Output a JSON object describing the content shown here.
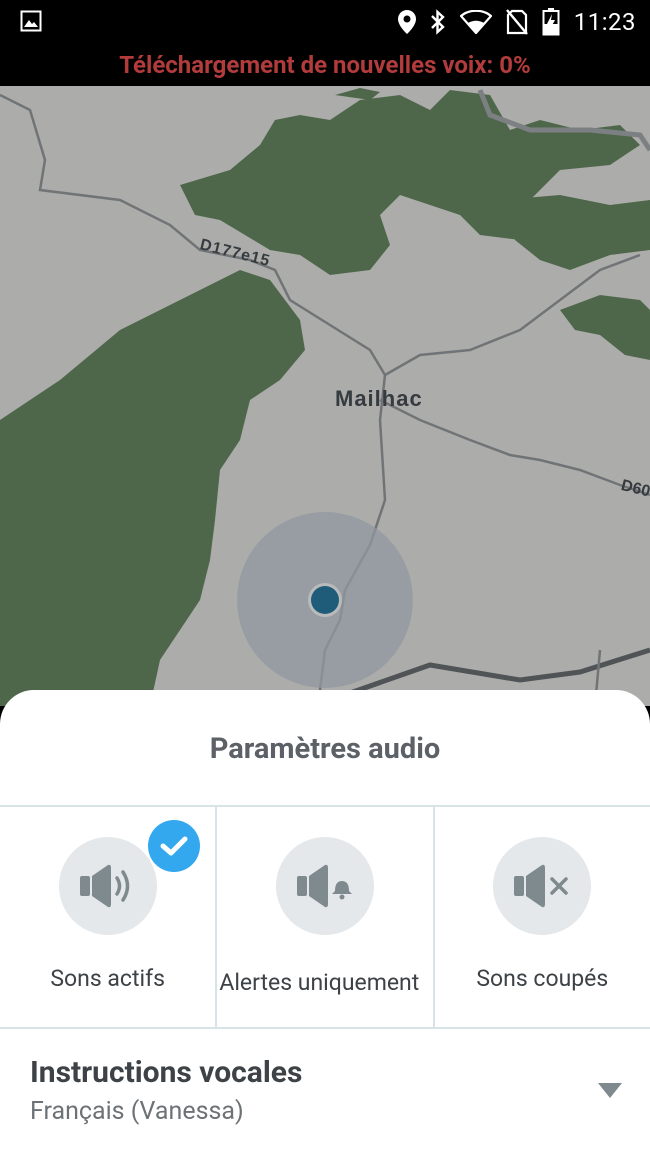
{
  "status_bar": {
    "time": "11:23",
    "icons": [
      "image-icon",
      "location-icon",
      "bluetooth-icon",
      "wifi-icon",
      "no-sim-icon",
      "battery-charging-icon"
    ]
  },
  "banner": {
    "text": "Téléchargement de nouvelles voix: 0%",
    "color": "#b23b3b"
  },
  "map": {
    "place_label": "Mailhac",
    "road_label_1": "D177e15",
    "road_label_2": "D60"
  },
  "sheet": {
    "title": "Paramètres audio",
    "options": [
      {
        "label": "Sons actifs",
        "icon": "speaker-on-icon",
        "selected": true
      },
      {
        "label": "Alertes uniquement",
        "icon": "speaker-bell-icon",
        "selected": false
      },
      {
        "label": "Sons coupés",
        "icon": "speaker-muted-icon",
        "selected": false
      }
    ],
    "voice": {
      "title": "Instructions vocales",
      "value": "Français (Vanessa)"
    }
  },
  "colors": {
    "accent": "#33a8ef",
    "icon_gray": "#7f8a8f",
    "map_green": "#6c8e66"
  }
}
